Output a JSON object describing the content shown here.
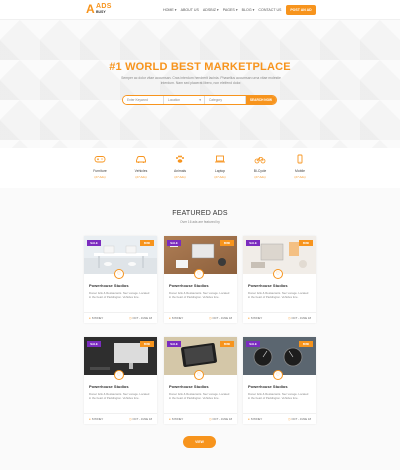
{
  "brand": {
    "mark": "A",
    "name": "ADS",
    "sub": "BUSY"
  },
  "nav": {
    "items": [
      "HOME ▾",
      "ABOUT US",
      "ADSBIZ ▾",
      "PAGES ▾",
      "BLOG ▾",
      "CONTACT US"
    ],
    "post_label": "POST AN AD"
  },
  "hero": {
    "title": "#1 WORLD BEST MARKETPLACE",
    "description": "Semper ac dolor vitae accumsan. Cras interdum hendrerit lacinia. Phasellus accumsan urna vitae molestie interdum. Nam sed placerat libero, non eleifend dolor.",
    "search": {
      "keyword_placeholder": "Enter Keyword",
      "location_value": "Location",
      "category_value": "Category",
      "button_label": "SEARCH NOW"
    }
  },
  "categories": [
    {
      "name": "Furniture",
      "count": "(27 Ads)",
      "icon": "gamepad-icon"
    },
    {
      "name": "Vehicles",
      "count": "(27 Ads)",
      "icon": "car-icon"
    },
    {
      "name": "Animals",
      "count": "(27 Ads)",
      "icon": "paw-icon"
    },
    {
      "name": "Laptop",
      "count": "(27 Ads)",
      "icon": "laptop-icon"
    },
    {
      "name": "Bi-Cycle",
      "count": "(27 Ads)",
      "icon": "bicycle-icon"
    },
    {
      "name": "Mobile",
      "count": "(27 Ads)",
      "icon": "mobile-icon"
    }
  ],
  "featured": {
    "title": "FEATURED ADS",
    "subtitle": "Over 16 ads are featured by",
    "more_label": "VIEW",
    "cards": [
      {
        "badge": "SALE",
        "price": "$580",
        "title": "Powerhouse Studios",
        "desc": "Donec felis & Restaurants. Nec vonage. Located in the heart of Paddington. Vehicles fore.",
        "location": "SYDNEY",
        "date": "OCT - JUNE 18"
      },
      {
        "badge": "SALE",
        "price": "$580",
        "title": "Powerhouse Studios",
        "desc": "Donec felis & Restaurants. Nec vonage. Located in the heart of Paddington. Vehicles fore.",
        "location": "SYDNEY",
        "date": "OCT - JUNE 18"
      },
      {
        "badge": "SALE",
        "price": "$580",
        "title": "Powerhouse Studios",
        "desc": "Donec felis & Restaurants. Nec vonage. Located in the heart of Paddington. Vehicles fore.",
        "location": "SYDNEY",
        "date": "OCT - JUNE 18"
      },
      {
        "badge": "SALE",
        "price": "$580",
        "title": "Powerhouse Studios",
        "desc": "Donec felis & Restaurants. Nec vonage. Located in the heart of Paddington. Vehicles fore.",
        "location": "SYDNEY",
        "date": "OCT - JUNE 18"
      },
      {
        "badge": "SALE",
        "price": "$580",
        "title": "Powerhouse Studios",
        "desc": "Donec felis & Restaurants. Nec vonage. Located in the heart of Paddington. Vehicles fore.",
        "location": "SYDNEY",
        "date": "OCT - JUNE 18"
      },
      {
        "badge": "SALE",
        "price": "$580",
        "title": "Powerhouse Studios",
        "desc": "Donec felis & Restaurants. Nec vonage. Located in the heart of Paddington. Vehicles fore.",
        "location": "SYDNEY",
        "date": "OCT - JUNE 18"
      }
    ]
  },
  "colors": {
    "accent": "#f7941d",
    "badge": "#7b2cbf"
  }
}
